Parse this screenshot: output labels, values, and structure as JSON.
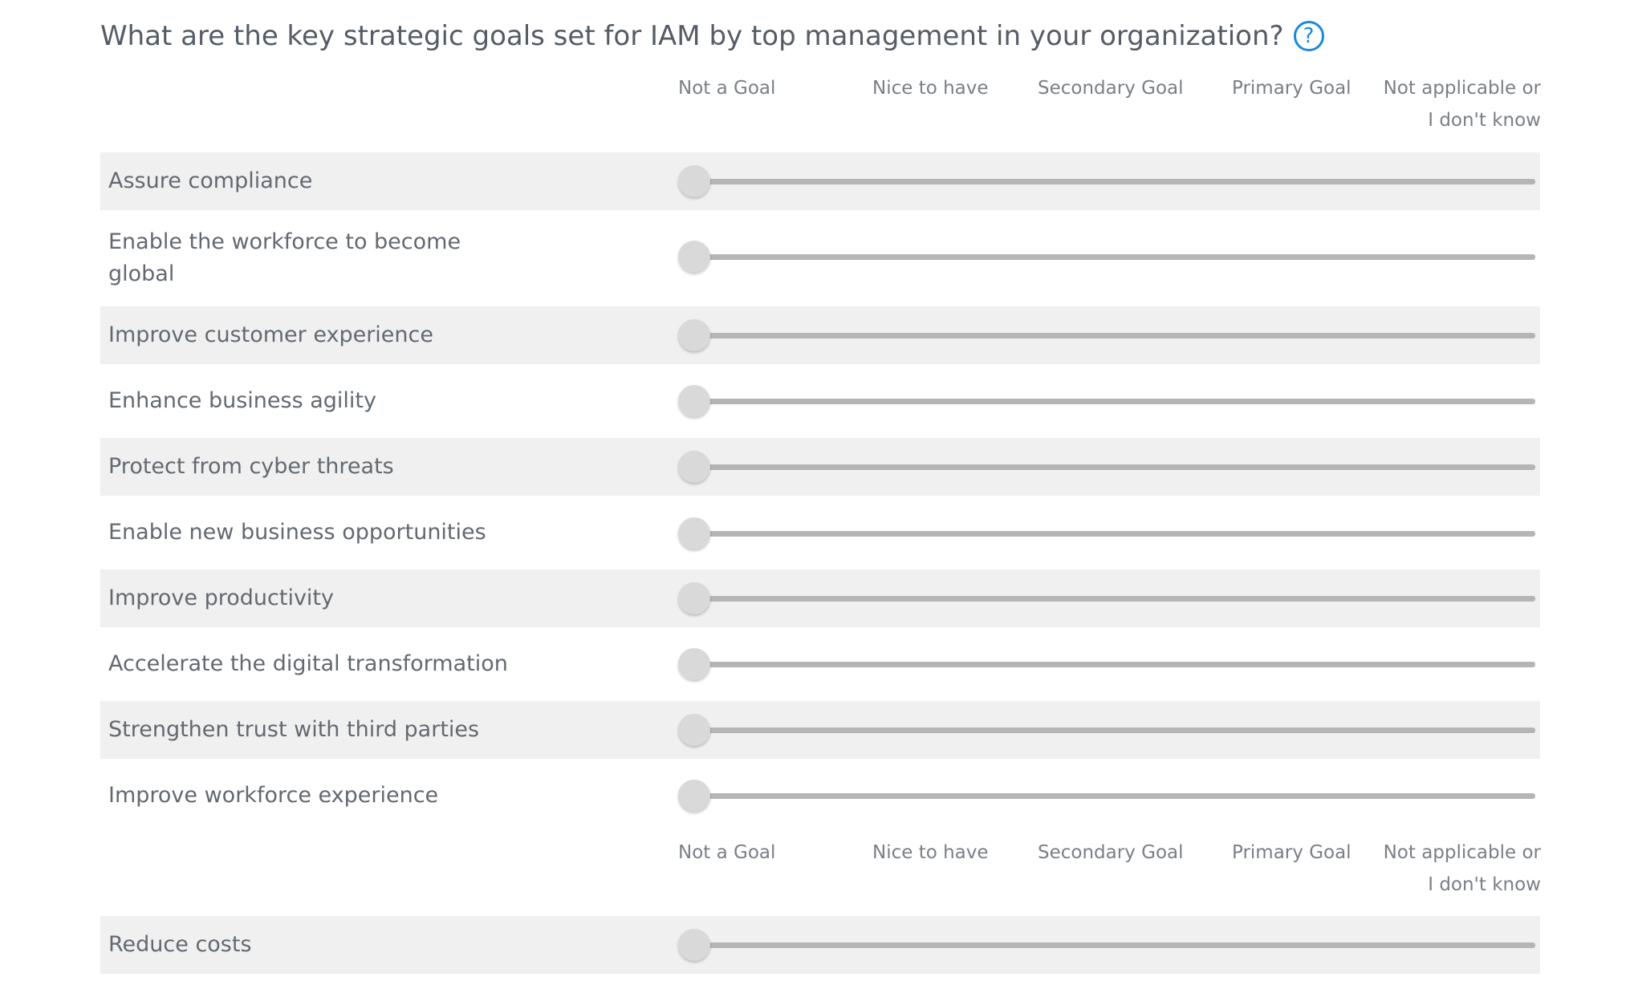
{
  "question": {
    "title": "What are the key strategic goals set for IAM by top management in your organization?",
    "help_glyph": "?"
  },
  "scale": {
    "labels": [
      "Not a Goal",
      "Nice to have",
      "Secondary Goal",
      "Primary Goal",
      "Not applicable or",
      "I don't know"
    ]
  },
  "rows": [
    {
      "label_line1": "Assure compliance",
      "label_line2": "",
      "value": "none"
    },
    {
      "label_line1": "Enable the workforce to become",
      "label_line2": "global",
      "value": "none"
    },
    {
      "label_line1": "Improve customer experience",
      "label_line2": "",
      "value": "none"
    },
    {
      "label_line1": "Enhance business agility",
      "label_line2": "",
      "value": "none"
    },
    {
      "label_line1": "Protect from cyber threats",
      "label_line2": "",
      "value": "none"
    },
    {
      "label_line1": "Enable new business opportunities",
      "label_line2": "",
      "value": "none"
    },
    {
      "label_line1": "Improve productivity",
      "label_line2": "",
      "value": "none"
    },
    {
      "label_line1": "Accelerate the digital transformation",
      "label_line2": "",
      "value": "none"
    },
    {
      "label_line1": "Strengthen trust with third parties",
      "label_line2": "",
      "value": "none"
    },
    {
      "label_line1": "Improve workforce experience",
      "label_line2": "",
      "value": "none"
    },
    {
      "label_line1": "Reduce costs",
      "label_line2": "",
      "value": "none"
    }
  ],
  "colors": {
    "accent": "#1a8ad8",
    "row_shade": "#f0f0f0",
    "track": "#b5b5b5",
    "handle": "#d9d9d9"
  }
}
